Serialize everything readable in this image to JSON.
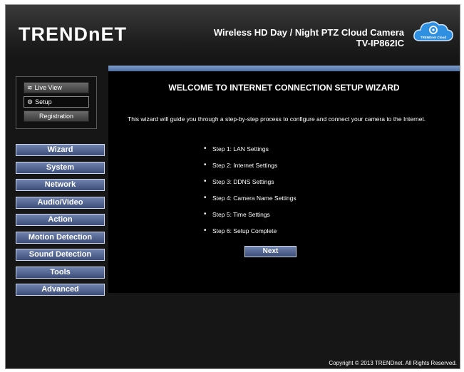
{
  "header": {
    "logo": "TRENDnET",
    "product_line": "Wireless HD Day / Night PTZ Cloud Camera",
    "model": "TV-IP862IC",
    "cloud_badge": "TRENDnet Cloud"
  },
  "modes": {
    "live_view": "Live View",
    "setup": "Setup",
    "registration": "Registration"
  },
  "menu": {
    "items": [
      "Wizard",
      "System",
      "Network",
      "Audio/Video",
      "Action",
      "Motion Detection",
      "Sound Detection",
      "Tools",
      "Advanced"
    ]
  },
  "panel": {
    "title": "WELCOME TO INTERNET CONNECTION SETUP WIZARD",
    "intro": "This wizard will guide you through a step-by-step process to configure and connect your camera to the Internet.",
    "steps": [
      "Step 1: LAN Settings",
      "Step 2: Internet Settings",
      "Step 3: DDNS Settings",
      "Step 4: Camera Name Settings",
      "Step 5: Time Settings",
      "Step 6: Setup Complete"
    ],
    "next_label": "Next"
  },
  "footer": {
    "copyright": "Copyright © 2013 TRENDnet. All Rights Reserved."
  },
  "colors": {
    "menu_button": "#4f6190",
    "panel_bar": "#6a8cbd",
    "background": "#161616"
  }
}
